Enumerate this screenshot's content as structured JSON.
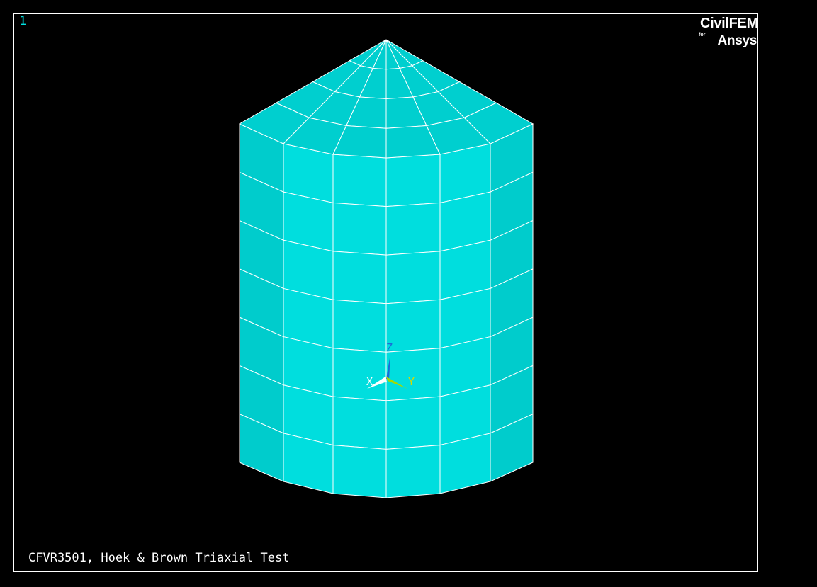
{
  "viewport": {
    "window_number": "1",
    "title": "CFVR3501, Hoek & Brown Triaxial Test"
  },
  "logo": {
    "top": "CivilFEM",
    "for": "for",
    "bottom": "Ansys"
  },
  "triad": {
    "x_label": "X",
    "y_label": "Y",
    "z_label": "Z"
  },
  "colors": {
    "background": "#000000",
    "mesh_face_front": "#00dede",
    "mesh_face_side": "#00cccc",
    "mesh_face_top": "#00cfcf",
    "mesh_lines": "#ffffff",
    "frame": "#ffffff"
  }
}
